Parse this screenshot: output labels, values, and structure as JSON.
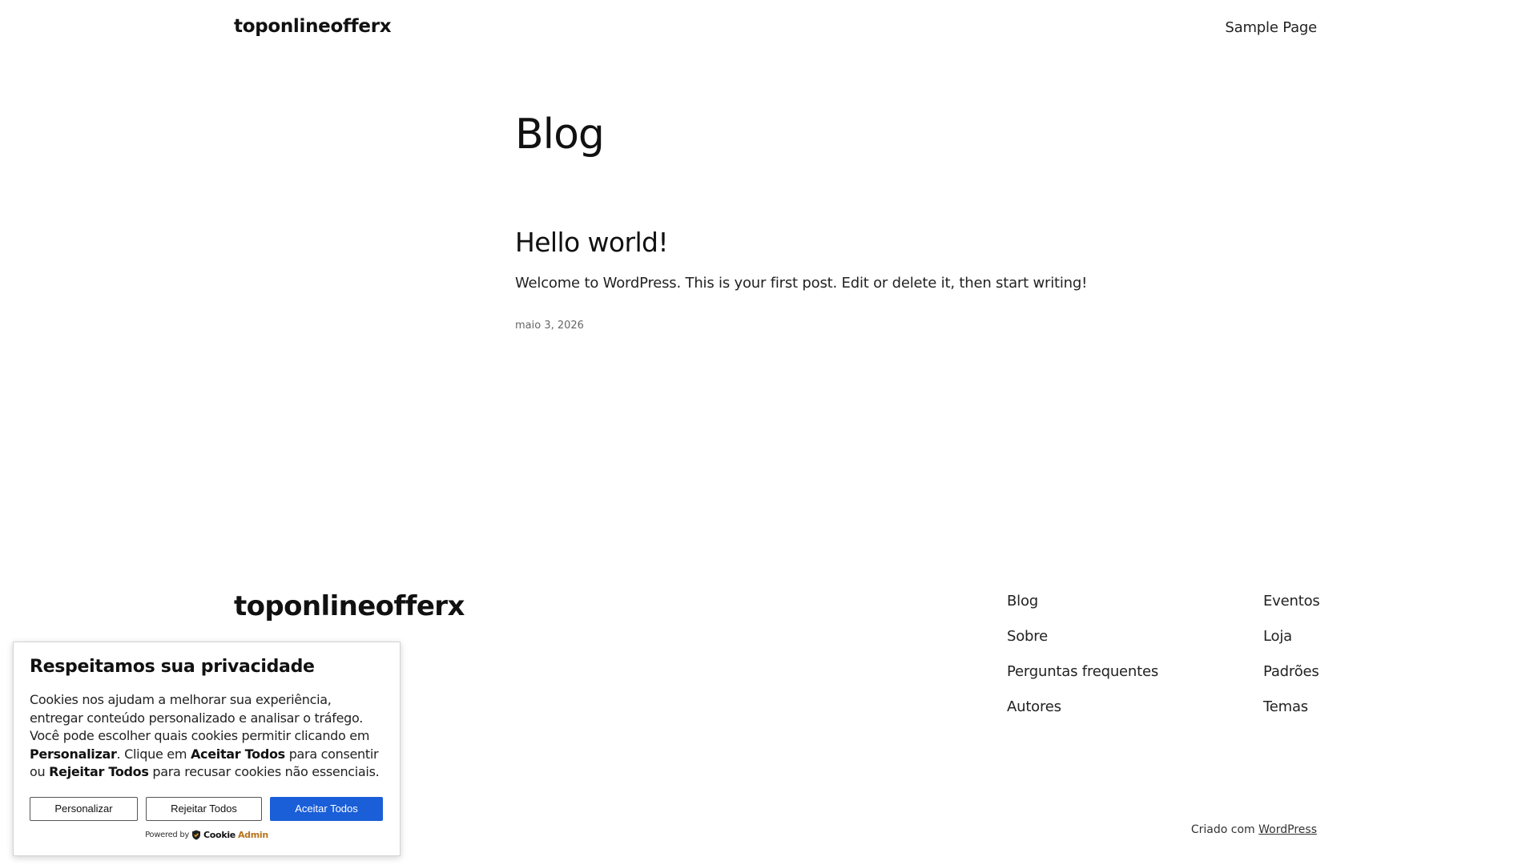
{
  "header": {
    "site_title": "toponlineofferx",
    "nav": [
      {
        "label": "Sample Page"
      }
    ]
  },
  "main": {
    "heading": "Blog",
    "posts": [
      {
        "title": "Hello world!",
        "excerpt": "Welcome to WordPress. This is your first post. Edit or delete it, then start writing!",
        "date": "maio 3, 2026"
      }
    ]
  },
  "footer": {
    "site_title": "toponlineofferx",
    "col1": [
      {
        "label": "Blog"
      },
      {
        "label": "Sobre"
      },
      {
        "label": "Perguntas frequentes"
      },
      {
        "label": "Autores"
      }
    ],
    "col2": [
      {
        "label": "Eventos"
      },
      {
        "label": "Loja"
      },
      {
        "label": "Padrões"
      },
      {
        "label": "Temas"
      }
    ],
    "credit_prefix": "Criado com",
    "credit_link": "WordPress"
  },
  "cookie": {
    "title": "Respeitamos sua privacidade",
    "text_1": "Cookies nos ajudam a melhorar sua experiência, entregar conteúdo personalizado e analisar o tráfego. Você pode escolher quais cookies permitir clicando em ",
    "text_bold_1": "Personalizar",
    "text_2": ". Clique em ",
    "text_bold_2": "Aceitar Todos",
    "text_3": " para consentir ou ",
    "text_bold_3": "Rejeitar Todos",
    "text_4": " para recusar cookies não essenciais.",
    "buttons": {
      "customize": "Personalizar",
      "reject": "Rejeitar Todos",
      "accept": "Aceitar Todos"
    },
    "powered_by": "Powered by",
    "brand_part_1": "Cookie",
    "brand_part_2": "Admin",
    "accent_color": "#1a5ed8",
    "brand_color": "#b8731a",
    "brand_icon": "shield-icon"
  }
}
